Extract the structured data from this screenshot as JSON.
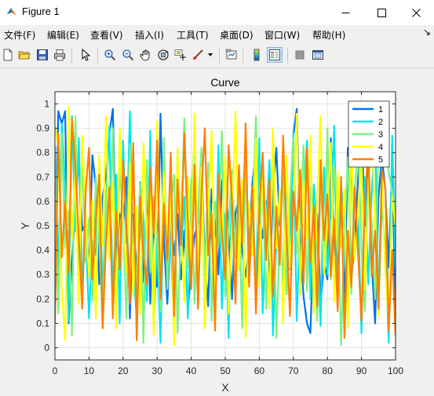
{
  "window": {
    "title": "Figure 1"
  },
  "menu": [
    {
      "label": "文件(F)"
    },
    {
      "label": "编辑(E)"
    },
    {
      "label": "查看(V)"
    },
    {
      "label": "插入(I)"
    },
    {
      "label": "工具(T)"
    },
    {
      "label": "桌面(D)"
    },
    {
      "label": "窗口(W)"
    },
    {
      "label": "帮助(H)"
    }
  ],
  "toolbar": [
    "new-figure",
    "open-file",
    "save",
    "print",
    "edit-plot",
    "zoom-in",
    "zoom-out",
    "pan",
    "rotate-3d",
    "data-cursor",
    "brush",
    "link-plot",
    "colorbar",
    "legend",
    "hide-plot-tools",
    "show-plot-tools"
  ],
  "colors": {
    "series1": "#0072e8",
    "series2": "#00e5f0",
    "series3": "#80f080",
    "series4": "#ffff00",
    "series5": "#ff7f00"
  },
  "chart_data": {
    "type": "line",
    "title": "Curve",
    "xlabel": "X",
    "ylabel": "Y",
    "xlim": [
      0,
      100
    ],
    "ylim": [
      -0.05,
      1.05
    ],
    "xticks": [
      "0",
      "10",
      "20",
      "30",
      "40",
      "50",
      "60",
      "70",
      "80",
      "90",
      "100"
    ],
    "yticks": [
      "0",
      "0.1",
      "0.2",
      "0.3",
      "0.4",
      "0.5",
      "0.6",
      "0.7",
      "0.8",
      "0.9",
      "1"
    ],
    "grid": true,
    "legend_position": "top-right",
    "x": [
      0,
      1,
      2,
      3,
      4,
      5,
      6,
      7,
      8,
      9,
      10,
      11,
      12,
      13,
      14,
      15,
      16,
      17,
      18,
      19,
      20,
      21,
      22,
      23,
      24,
      25,
      26,
      27,
      28,
      29,
      30,
      31,
      32,
      33,
      34,
      35,
      36,
      37,
      38,
      39,
      40,
      41,
      42,
      43,
      44,
      45,
      46,
      47,
      48,
      49,
      50,
      51,
      52,
      53,
      54,
      55,
      56,
      57,
      58,
      59,
      60,
      61,
      62,
      63,
      64,
      65,
      66,
      67,
      68,
      69,
      70,
      71,
      72,
      73,
      74,
      75,
      76,
      77,
      78,
      79,
      80,
      81,
      82,
      83,
      84,
      85,
      86,
      87,
      88,
      89,
      90,
      91,
      92,
      93,
      94,
      95,
      96,
      97,
      98,
      99,
      100
    ],
    "series": [
      {
        "name": "1",
        "values": [
          0.24,
          0.97,
          0.92,
          0.97,
          0.1,
          0.36,
          0.55,
          0.78,
          0.48,
          0.51,
          0.32,
          0.79,
          0.66,
          0.26,
          0.62,
          0.71,
          0.88,
          0.98,
          0.35,
          0.55,
          0.5,
          0.7,
          0.12,
          0.55,
          0.3,
          0.52,
          0.27,
          0.62,
          0.18,
          0.54,
          0.25,
          0.96,
          0.44,
          0.18,
          0.52,
          0.38,
          0.55,
          0.28,
          0.48,
          0.15,
          0.32,
          0.46,
          0.51,
          0.8,
          0.36,
          0.17,
          0.65,
          0.52,
          0.3,
          0.68,
          0.73,
          0.46,
          0.2,
          0.55,
          0.62,
          0.39,
          0.29,
          0.42,
          0.68,
          0.8,
          0.55,
          0.45,
          0.6,
          0.25,
          0.63,
          0.82,
          0.5,
          0.72,
          0.22,
          0.58,
          0.87,
          0.98,
          0.42,
          0.21,
          0.1,
          0.06,
          0.48,
          0.55,
          0.18,
          0.35,
          0.28,
          0.86,
          0.42,
          0.3,
          0.62,
          0.18,
          0.82,
          0.27,
          0.44,
          0.7,
          0.92,
          0.5,
          0.82,
          0.35,
          0.1,
          0.62,
          0.78,
          0.65,
          0.33,
          0.75,
          0.15
        ]
      },
      {
        "name": "2",
        "values": [
          0.83,
          0.31,
          0.92,
          0.67,
          0.11,
          0.95,
          0.48,
          0.86,
          0.25,
          0.49,
          0.12,
          0.44,
          0.38,
          0.7,
          0.23,
          0.59,
          0.91,
          0.16,
          0.71,
          0.1,
          0.85,
          0.43,
          0.97,
          0.34,
          0.12,
          0.68,
          0.52,
          0.19,
          0.89,
          0.08,
          0.45,
          0.02,
          0.65,
          0.31,
          0.43,
          0.09,
          0.8,
          0.38,
          0.62,
          0.12,
          0.56,
          0.88,
          0.28,
          0.72,
          0.08,
          0.67,
          0.48,
          0.23,
          0.83,
          0.16,
          0.55,
          0.04,
          0.71,
          0.4,
          0.58,
          0.09,
          0.79,
          0.35,
          0.65,
          0.22,
          0.86,
          0.14,
          0.51,
          0.77,
          0.05,
          0.44,
          0.61,
          0.24,
          0.73,
          0.32,
          0.88,
          0.11,
          0.56,
          0.62,
          0.85,
          0.2,
          0.67,
          0.45,
          0.09,
          0.74,
          0.3,
          0.57,
          0.91,
          0.18,
          0.68,
          0.49,
          0.12,
          0.81,
          0.37,
          0.54,
          0.06,
          0.7,
          0.26,
          0.63,
          0.88,
          0.15,
          0.59,
          0.42,
          0.02,
          0.87,
          0.33
        ]
      },
      {
        "name": "3",
        "values": [
          0.63,
          0.14,
          0.88,
          0.41,
          0.56,
          0.05,
          0.95,
          0.27,
          0.79,
          0.35,
          0.53,
          0.19,
          0.7,
          0.47,
          0.08,
          0.65,
          0.38,
          0.9,
          0.2,
          0.74,
          0.54,
          0.12,
          0.83,
          0.4,
          0.29,
          0.67,
          0.02,
          0.77,
          0.31,
          0.62,
          0.47,
          0.15,
          0.86,
          0.24,
          0.58,
          0.71,
          0.06,
          0.49,
          0.94,
          0.33,
          0.69,
          0.18,
          0.55,
          0.82,
          0.28,
          0.76,
          0.11,
          0.6,
          0.42,
          0.89,
          0.21,
          0.5,
          0.73,
          0.37,
          0.64,
          0.08,
          0.81,
          0.26,
          0.52,
          0.95,
          0.33,
          0.68,
          0.16,
          0.57,
          0.79,
          0.04,
          0.45,
          0.72,
          0.22,
          0.61,
          0.86,
          0.39,
          0.52,
          0.83,
          0.23,
          0.66,
          0.45,
          0.11,
          0.71,
          0.35,
          0.9,
          0.28,
          0.74,
          0.58,
          0.01,
          0.47,
          0.78,
          0.22,
          0.63,
          0.85,
          0.41,
          0.15,
          0.69,
          0.52,
          0.2,
          0.84,
          0.79,
          0.9,
          0.72,
          0.64,
          0.55
        ]
      },
      {
        "name": "4",
        "values": [
          0.91,
          0.82,
          0.24,
          0.03,
          0.99,
          0.45,
          0.71,
          0.18,
          0.87,
          0.55,
          0.29,
          0.6,
          0.12,
          0.79,
          0.42,
          0.95,
          0.36,
          0.68,
          0.08,
          0.9,
          0.51,
          0.31,
          0.76,
          0.21,
          0.58,
          0.14,
          0.84,
          0.45,
          0.67,
          0.05,
          0.93,
          0.27,
          0.72,
          0.39,
          0.63,
          0.01,
          0.82,
          0.48,
          0.19,
          0.7,
          0.36,
          0.96,
          0.29,
          0.74,
          0.08,
          0.55,
          0.89,
          0.22,
          0.66,
          0.43,
          0.79,
          0.14,
          0.51,
          0.97,
          0.32,
          0.69,
          0.04,
          0.6,
          0.38,
          0.86,
          0.25,
          0.74,
          0.53,
          0.16,
          0.9,
          0.41,
          0.65,
          0.1,
          0.79,
          0.33,
          0.57,
          0.96,
          0.22,
          0.68,
          0.45,
          0.87,
          0.14,
          0.61,
          0.95,
          0.3,
          0.52,
          0.84,
          0.19,
          0.72,
          0.41,
          0.65,
          0.08,
          0.91,
          0.36,
          0.56,
          0.78,
          0.24,
          0.63,
          0.95,
          0.47,
          0.13,
          0.72,
          0.31,
          0.1,
          0.62,
          0.5
        ]
      },
      {
        "name": "5",
        "values": [
          0.1,
          0.88,
          0.37,
          0.6,
          0.31,
          0.94,
          0.74,
          0.45,
          0.16,
          0.64,
          0.82,
          0.28,
          0.53,
          0.71,
          0.08,
          0.43,
          0.66,
          0.12,
          0.56,
          0.32,
          0.77,
          0.5,
          0.18,
          0.84,
          0.03,
          0.62,
          0.37,
          0.26,
          0.74,
          0.47,
          0.85,
          0.2,
          0.59,
          0.36,
          0.8,
          0.13,
          0.69,
          0.42,
          0.88,
          0.52,
          0.24,
          0.75,
          0.16,
          0.63,
          0.9,
          0.38,
          0.55,
          0.07,
          0.71,
          0.47,
          0.28,
          0.83,
          0.6,
          0.18,
          0.75,
          0.43,
          0.92,
          0.25,
          0.66,
          0.14,
          0.57,
          0.8,
          0.36,
          0.69,
          0.21,
          0.58,
          0.34,
          0.87,
          0.46,
          0.13,
          0.64,
          0.48,
          0.73,
          0.26,
          0.82,
          0.35,
          0.58,
          0.17,
          0.77,
          0.44,
          0.63,
          0.29,
          0.53,
          0.15,
          0.7,
          0.04,
          0.48,
          0.25,
          0.66,
          0.38,
          0.11,
          0.59,
          0.83,
          0.29,
          0.48,
          0.16,
          0.73,
          0.66,
          0.07,
          0.4,
          0.05
        ]
      }
    ]
  }
}
